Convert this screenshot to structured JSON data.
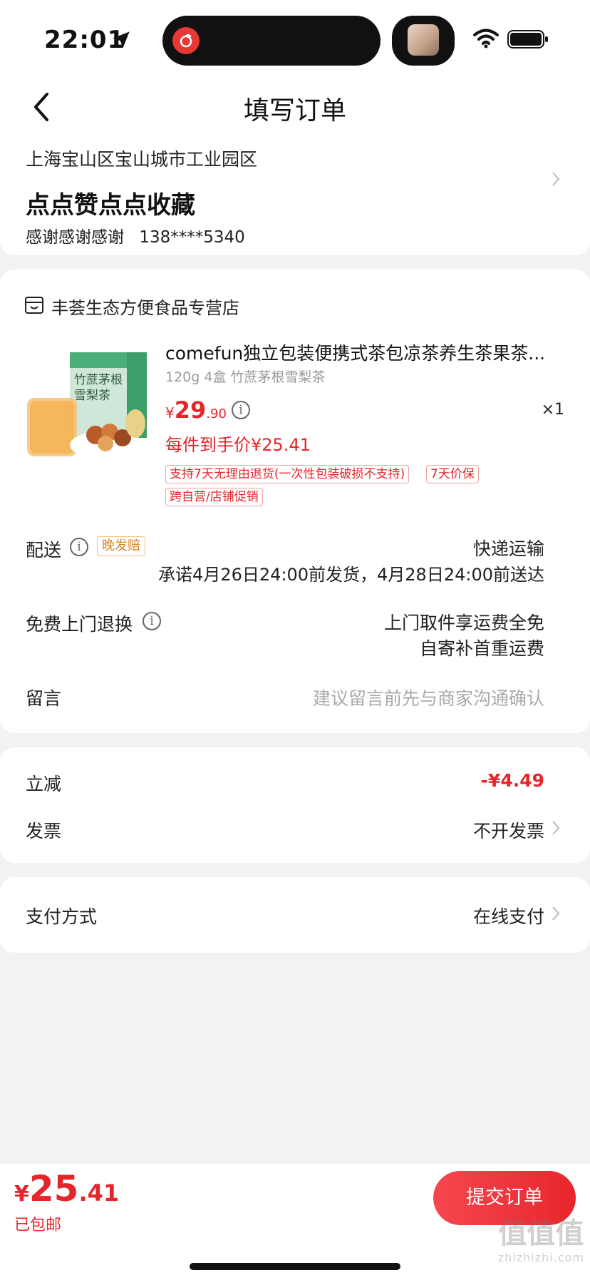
{
  "status_bar": {
    "time": "22:01"
  },
  "nav": {
    "title": "填写订单"
  },
  "address": {
    "region": "上海宝山区宝山城市工业园区",
    "detail": "点点赞点点收藏",
    "name": "感谢感谢感谢",
    "phone": "138****5340"
  },
  "store": {
    "name": "丰荟生态方便食品专营店"
  },
  "product": {
    "title": "comefun独立包装便携式茶包凉茶养生茶果茶...",
    "spec": "120g 4盒 竹蔗茅根雪梨茶",
    "price_symbol": "¥",
    "price_int": "29",
    "price_dec": ".90",
    "quantity": "×1",
    "hand_price": "每件到手价¥25.41",
    "image_text": "竹蔗茅根雪梨茶",
    "tags": [
      "支持7天无理由退货(一次性包装破损不支持)",
      "7天价保",
      "跨自营/店铺促销"
    ]
  },
  "delivery": {
    "label": "配送",
    "late_tag": "晚发赔",
    "method": "快递运输",
    "promise": "承诺4月26日24:00前发货，4月28日24:00前送达"
  },
  "return": {
    "label": "免费上门退换",
    "line1": "上门取件享运费全免",
    "line2": "自寄补首重运费"
  },
  "message": {
    "label": "留言",
    "placeholder": "建议留言前先与商家沟通确认"
  },
  "discount": {
    "label": "立减",
    "value": "-¥4.49"
  },
  "invoice": {
    "label": "发票",
    "value": "不开发票"
  },
  "payment": {
    "label": "支付方式",
    "value": "在线支付"
  },
  "footer": {
    "total_symbol": "¥",
    "total_int": "25",
    "total_dec": ".41",
    "shipping": "已包邮",
    "submit_label": "提交订单",
    "watermark": "值值值",
    "watermark_url": "zhizhizhi.com"
  },
  "colors": {
    "accent": "#e4262b",
    "background": "#f2f2f2",
    "tag_border": "#f0a3a3"
  },
  "icons": [
    "location-arrow-icon",
    "wifi-icon",
    "battery-icon",
    "back-icon",
    "store-icon",
    "info-icon",
    "chevron-right-icon"
  ]
}
